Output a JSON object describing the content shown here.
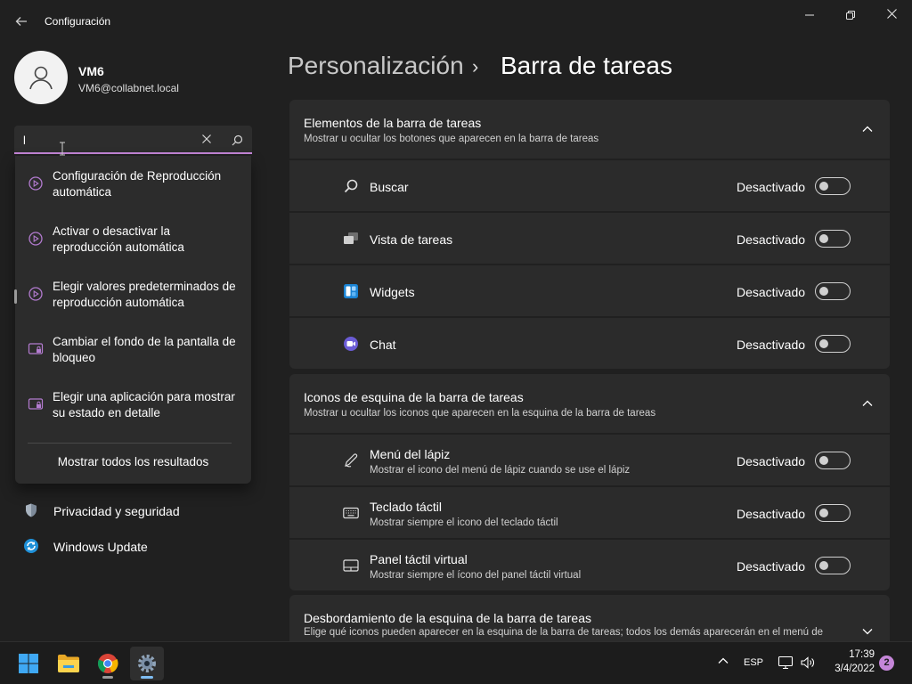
{
  "window": {
    "title": "Configuración"
  },
  "user": {
    "name": "VM6",
    "email": "VM6@collabnet.local"
  },
  "search": {
    "value": "l",
    "placeholder": ""
  },
  "search_results": [
    {
      "label": "Configuración de Reproducción automática",
      "icon": "autoplay-icon"
    },
    {
      "label": "Activar o desactivar la reproducción automática",
      "icon": "autoplay-icon"
    },
    {
      "label": "Elegir valores predeterminados de reproducción automática",
      "icon": "autoplay-icon"
    },
    {
      "label": "Cambiar el fondo de la pantalla de bloqueo",
      "icon": "lock-screen-icon"
    },
    {
      "label": "Elegir una aplicación para mostrar su estado en detalle",
      "icon": "lock-screen-icon"
    }
  ],
  "search_show_all": "Mostrar todos los resultados",
  "nav": {
    "items": [
      {
        "label": "Privacidad y seguridad",
        "icon": "shield-icon"
      },
      {
        "label": "Windows Update",
        "icon": "windows-update-icon"
      }
    ]
  },
  "breadcrumb": {
    "parent": "Personalización",
    "separator": "›",
    "current": "Barra de tareas"
  },
  "sections": [
    {
      "title": "Elementos de la barra de tareas",
      "subtitle": "Mostrar u ocultar los botones que aparecen en la barra de tareas",
      "expanded": true,
      "rows": [
        {
          "label": "Buscar",
          "desc": "",
          "state": "Desactivado",
          "on": false,
          "icon": "search-icon"
        },
        {
          "label": "Vista de tareas",
          "desc": "",
          "state": "Desactivado",
          "on": false,
          "icon": "task-view-icon"
        },
        {
          "label": "Widgets",
          "desc": "",
          "state": "Desactivado",
          "on": false,
          "icon": "widgets-icon"
        },
        {
          "label": "Chat",
          "desc": "",
          "state": "Desactivado",
          "on": false,
          "icon": "chat-icon"
        }
      ]
    },
    {
      "title": "Iconos de esquina de la barra de tareas",
      "subtitle": "Mostrar u ocultar los iconos que aparecen en la esquina de la barra de tareas",
      "expanded": true,
      "rows": [
        {
          "label": "Menú del lápiz",
          "desc": "Mostrar el icono del menú de lápiz cuando se use el lápiz",
          "state": "Desactivado",
          "on": false,
          "icon": "pen-icon"
        },
        {
          "label": "Teclado táctil",
          "desc": "Mostrar siempre el icono del teclado táctil",
          "state": "Desactivado",
          "on": false,
          "icon": "keyboard-icon"
        },
        {
          "label": "Panel táctil virtual",
          "desc": "Mostrar siempre el ícono del panel táctil virtual",
          "state": "Desactivado",
          "on": false,
          "icon": "touchpad-icon"
        }
      ]
    },
    {
      "title": "Desbordamiento de la esquina de la barra de tareas",
      "subtitle": "Elige qué iconos pueden aparecer en la esquina de la barra de tareas; todos los demás aparecerán en el menú de",
      "expanded": false,
      "rows": []
    }
  ],
  "taskbar": {
    "apps": [
      {
        "name": "Inicio",
        "icon": "windows-start-icon"
      },
      {
        "name": "Explorador de archivos",
        "icon": "file-explorer-icon"
      },
      {
        "name": "Google Chrome",
        "icon": "chrome-icon"
      },
      {
        "name": "Configuración",
        "icon": "settings-icon"
      }
    ],
    "language": "ESP",
    "time": "17:39",
    "date": "3/4/2022",
    "notifications": "2"
  },
  "colors": {
    "accent": "#c586d8",
    "background": "#202020",
    "card": "#2b2b2b"
  }
}
